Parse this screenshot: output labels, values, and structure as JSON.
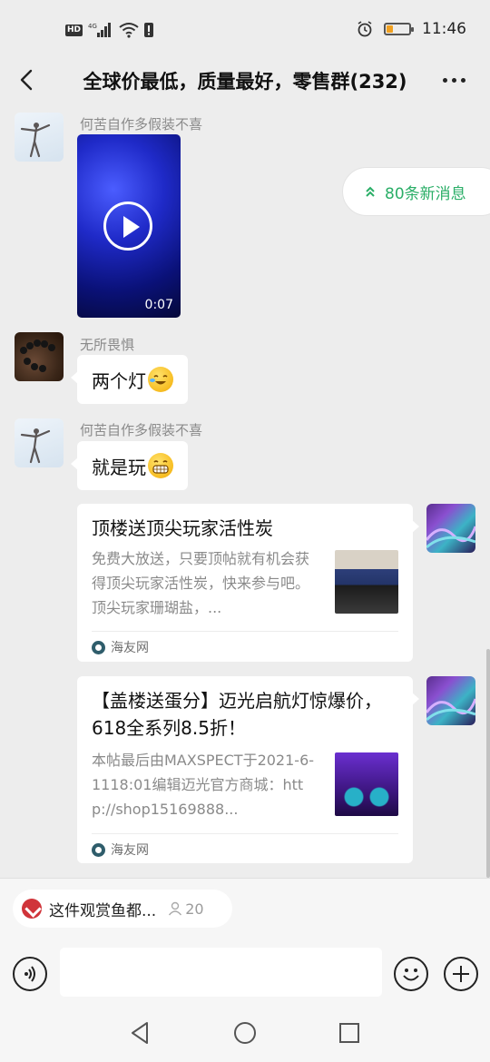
{
  "status_bar": {
    "time": "11:46",
    "network_label": "4G",
    "hd_label": "HD",
    "battery_level": 0.25
  },
  "header": {
    "title": "全球价最低，质量最好，零售群(232)"
  },
  "new_messages_badge": {
    "label": "80条新消息"
  },
  "messages": [
    {
      "sender": "何苦自作多假装不喜",
      "type": "video",
      "duration": "0:07"
    },
    {
      "sender": "无所畏惧",
      "type": "text",
      "text": "两个灯"
    },
    {
      "sender": "何苦自作多假装不喜",
      "type": "text",
      "text": "就是玩"
    }
  ],
  "link_cards": [
    {
      "title": "顶楼送顶尖玩家活性炭",
      "desc": "免费大放送，只要顶帖就有机会获得顶尖玩家活性炭，快来参与吧。顶尖玩家珊瑚盐，...",
      "source": "海友网"
    },
    {
      "title": "【盖楼送蛋分】迈光启航灯惊爆价，618全系列8.5折！",
      "desc": "本帖最后由MAXSPECT于2021-6-1118:01编辑迈光官方商城：http://shop15169888...",
      "source": "海友网"
    }
  ],
  "pinned_topic": {
    "label": "这件观赏鱼都...",
    "participants": "20"
  },
  "input": {
    "placeholder": ""
  },
  "colors": {
    "accent_green": "#2aae67",
    "background": "#ededed",
    "video_blue": "#1f2ac8"
  }
}
